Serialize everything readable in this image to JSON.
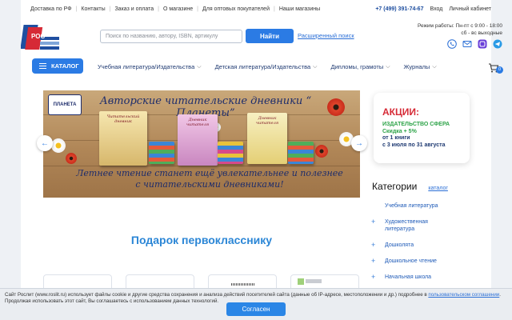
{
  "topbar": {
    "links": [
      "Доставка по РФ",
      "Контакты",
      "Заказ и оплата",
      "О магазине",
      "Для оптовых покупателей",
      "Наши магазины"
    ],
    "phone": "+7 (499) 391-74-67",
    "login": "Вход",
    "account": "Личный кабинет"
  },
  "header": {
    "search_placeholder": "Поиск по названию, автору, ISBN, артикулу",
    "search_button": "Найти",
    "advanced_search": "Расширенный поиск",
    "hours_line1": "Режим работы: Пн-пт с 9:00 - 18:00",
    "hours_line2": "сб - вс выходные",
    "social_icons": [
      "phone-icon",
      "mail-icon",
      "vk-icon",
      "telegram-icon"
    ]
  },
  "nav": {
    "catalog_label": "КАТАЛОГ",
    "items": [
      "Учебная литература/Издательства",
      "Детская литература/Издательства",
      "Дипломы, грамоты",
      "Журналы"
    ],
    "cart_count": "0"
  },
  "banner": {
    "brand": "ПЛАНЕТА",
    "title": "Авторские читательские дневники “ Планеты”",
    "subtitle_line1": "Летнее чтение станет ещё увлекательнее и полезнее",
    "subtitle_line2": "с читательскими дневниками!",
    "book_titles": [
      "Читательский дневник",
      "Дневник читателя",
      "Дневник читателя"
    ]
  },
  "promo": {
    "title": "АКЦИИ:",
    "line1": "ИЗДАТЕЛЬСТВО СФЕРА",
    "line2": "Скидка + 5%",
    "line3": "от 1 книги",
    "line4": "с 3 июля по 31 августа"
  },
  "categories": {
    "heading": "Категории",
    "catalog_link": "каталог",
    "items": [
      {
        "label": "Учебная литература",
        "expandable": false
      },
      {
        "label": "Художественная литература",
        "expandable": true
      },
      {
        "label": "Дошколята",
        "expandable": true
      },
      {
        "label": "Дошкольное чтение",
        "expandable": true
      },
      {
        "label": "Начальная школа",
        "expandable": true
      }
    ]
  },
  "gift": {
    "title": "Подарок первокласснику"
  },
  "cookie": {
    "text_before": "Сайт Рослит (www.roslit.ru) использует файлы cookie и другие средства сохранения и анализа действий посетителей сайта (данные об IP-адресе, местоположении и др.) подробнее в ",
    "link": "пользовательском соглашении",
    "text_after": ". Продолжая использовать этот сайт, Вы соглашаетесь с использованием данных технологий.",
    "button": "Согласен"
  }
}
